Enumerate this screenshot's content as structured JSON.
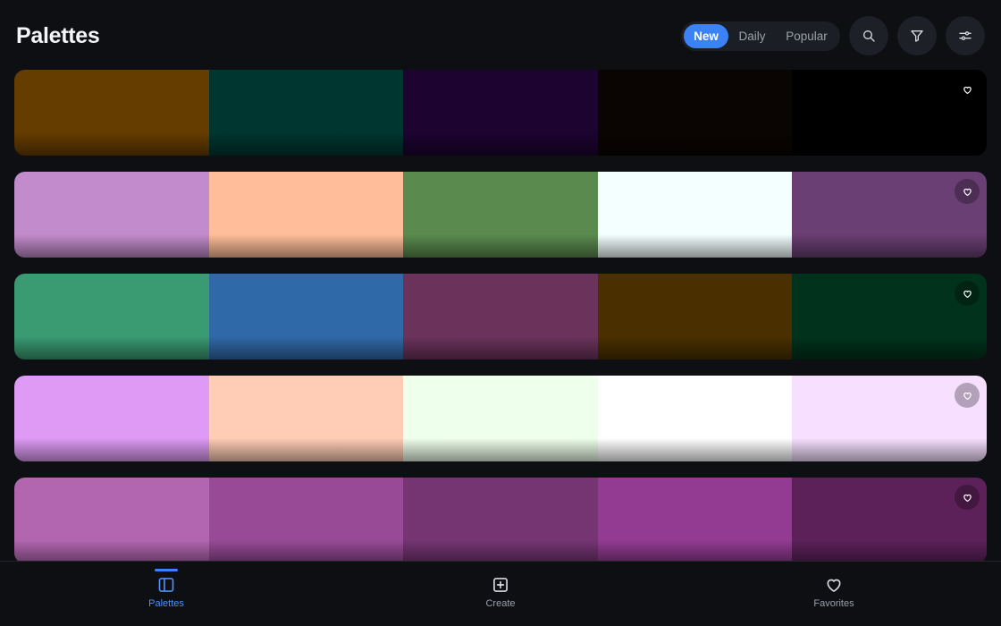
{
  "header": {
    "title": "Palettes",
    "tabs": [
      {
        "label": "New",
        "active": true
      },
      {
        "label": "Daily",
        "active": false
      },
      {
        "label": "Popular",
        "active": false
      }
    ],
    "actions": [
      "search-icon",
      "filter-icon",
      "sliders-icon"
    ]
  },
  "palettes": [
    {
      "colors": [
        "#663D00",
        "#003630",
        "#1D0330",
        "#0A0402",
        "#000000"
      ]
    },
    {
      "colors": [
        "#C28BCC",
        "#FFBE99",
        "#5A8A4E",
        "#F4FFFF",
        "#6A3F73"
      ]
    },
    {
      "colors": [
        "#3A9A72",
        "#3069A8",
        "#6B335C",
        "#4A3000",
        "#00321C"
      ]
    },
    {
      "colors": [
        "#DE9AF4",
        "#FFCCB5",
        "#EEFFEB",
        "#FFFFFF",
        "#F7E0FF"
      ]
    },
    {
      "colors": [
        "#B266B0",
        "#984A96",
        "#753572",
        "#933B92",
        "#5C2159"
      ]
    }
  ],
  "nav": {
    "items": [
      {
        "label": "Palettes",
        "icon": "panel-icon",
        "active": true
      },
      {
        "label": "Create",
        "icon": "plus-square-icon",
        "active": false
      },
      {
        "label": "Favorites",
        "icon": "heart-icon",
        "active": false
      }
    ]
  },
  "colors": {
    "background": "#0E0F13",
    "accent": "#3B82F6",
    "muted_text": "#9AA0AB"
  }
}
